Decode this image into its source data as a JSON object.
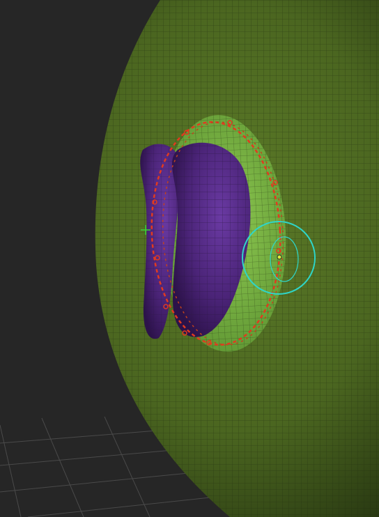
{
  "viewport": {
    "background_color": "#262626",
    "sphere_color": "#4e6a22",
    "sphere_shadow_color": "#223010",
    "wire_color": "#1f2a10",
    "mask_color": "#77b33f",
    "inset_color": "#5a2f8a",
    "curve_color": "#e23a1f",
    "gizmo_color": "#2ed6c9",
    "axis_marker_color": "#3bd23b",
    "floor_grid_color": "#4a4a4a"
  },
  "icons": [
    "sphere-mesh",
    "insert-mesh-inset",
    "red-curve-handles",
    "transpose-gizmo-ring"
  ]
}
